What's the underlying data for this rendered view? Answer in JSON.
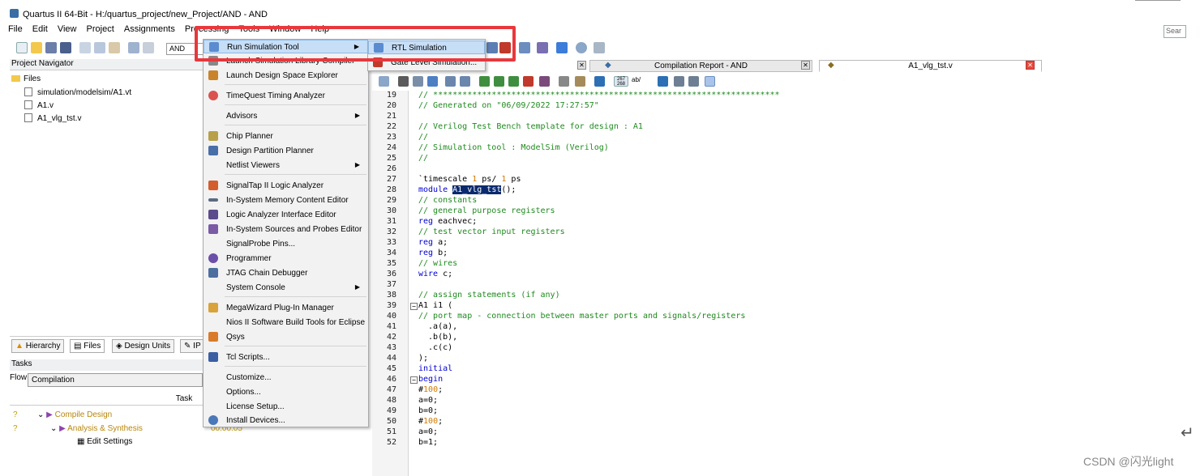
{
  "window": {
    "title": "Quartus II 64-Bit - H:/quartus_project/new_Project/AND - AND"
  },
  "menubar": [
    "File",
    "Edit",
    "View",
    "Project",
    "Assignments",
    "Processing",
    "Tools",
    "Window",
    "Help"
  ],
  "search_placeholder": "Sear",
  "toolbar": {
    "entity": "AND"
  },
  "project_navigator": {
    "title": "Project Navigator",
    "root": "Files",
    "files": [
      "simulation/modelsim/A1.vt",
      "A1.v",
      "A1_vlg_tst.v"
    ]
  },
  "panel_tabs": [
    "Hierarchy",
    "Files",
    "Design Units",
    "IP"
  ],
  "tasks": {
    "title": "Tasks",
    "flow_label": "Flow:",
    "flow_value": "Compilation",
    "column": "Task",
    "rows": [
      {
        "status": "?",
        "name": "Compile Design",
        "time": ""
      },
      {
        "status": "?",
        "name": "Analysis & Synthesis",
        "time": "00:00:05"
      },
      {
        "status": "",
        "name": "Edit Settings",
        "time": ""
      }
    ]
  },
  "editor_tabs": [
    {
      "label": "Compilation Report - AND"
    },
    {
      "label": "A1_vlg_tst.v"
    }
  ],
  "editor_toolbar": {
    "counter": "267\n268",
    "ab": "ab/"
  },
  "code": {
    "lines": [
      {
        "n": "19",
        "t": "// ***********************************************************************",
        "cls": "c-comment"
      },
      {
        "n": "20",
        "t": "// Generated on \"06/09/2022 17:27:57\"",
        "cls": "c-comment"
      },
      {
        "n": "21",
        "t": "",
        "cls": ""
      },
      {
        "n": "22",
        "t": "// Verilog Test Bench template for design : A1",
        "cls": "c-comment"
      },
      {
        "n": "23",
        "t": "//",
        "cls": "c-comment"
      },
      {
        "n": "24",
        "t": "// Simulation tool : ModelSim (Verilog)",
        "cls": "c-comment"
      },
      {
        "n": "25",
        "t": "//",
        "cls": "c-comment"
      },
      {
        "n": "26",
        "t": "",
        "cls": ""
      },
      {
        "n": "27",
        "t": "`timescale 1 ps/ 1 ps",
        "cls": ""
      },
      {
        "n": "28",
        "t": "module A1_vlg_tst();",
        "cls": ""
      },
      {
        "n": "29",
        "t": "// constants",
        "cls": "c-comment"
      },
      {
        "n": "30",
        "t": "// general purpose registers",
        "cls": "c-comment"
      },
      {
        "n": "31",
        "t": "reg eachvec;",
        "cls": ""
      },
      {
        "n": "32",
        "t": "// test vector input registers",
        "cls": "c-comment"
      },
      {
        "n": "33",
        "t": "reg a;",
        "cls": ""
      },
      {
        "n": "34",
        "t": "reg b;",
        "cls": ""
      },
      {
        "n": "35",
        "t": "// wires",
        "cls": "c-comment"
      },
      {
        "n": "36",
        "t": "wire c;",
        "cls": ""
      },
      {
        "n": "37",
        "t": "",
        "cls": ""
      },
      {
        "n": "38",
        "t": "// assign statements (if any)",
        "cls": "c-comment"
      },
      {
        "n": "39",
        "t": "A1 i1 (",
        "cls": ""
      },
      {
        "n": "40",
        "t": "// port map - connection between master ports and signals/registers",
        "cls": "c-comment"
      },
      {
        "n": "41",
        "t": "  .a(a),",
        "cls": ""
      },
      {
        "n": "42",
        "t": "  .b(b),",
        "cls": ""
      },
      {
        "n": "43",
        "t": "  .c(c)",
        "cls": ""
      },
      {
        "n": "44",
        "t": ");",
        "cls": ""
      },
      {
        "n": "45",
        "t": "initial",
        "cls": "c-kw"
      },
      {
        "n": "46",
        "t": "begin",
        "cls": "c-kw"
      },
      {
        "n": "47",
        "t": "#100;",
        "cls": ""
      },
      {
        "n": "48",
        "t": "a=0;",
        "cls": ""
      },
      {
        "n": "49",
        "t": "b=0;",
        "cls": ""
      },
      {
        "n": "50",
        "t": "#100;",
        "cls": ""
      },
      {
        "n": "51",
        "t": "a=0;",
        "cls": ""
      },
      {
        "n": "52",
        "t": "b=1;",
        "cls": ""
      }
    ]
  },
  "tools_menu": {
    "items": [
      "Run Simulation Tool",
      "Launch Simulation Library Compiler",
      "Launch Design Space Explorer",
      "TimeQuest Timing Analyzer",
      "Advisors",
      "Chip Planner",
      "Design Partition Planner",
      "Netlist Viewers",
      "SignalTap II Logic Analyzer",
      "In-System Memory Content Editor",
      "Logic Analyzer Interface Editor",
      "In-System Sources and Probes Editor",
      "SignalProbe Pins...",
      "Programmer",
      "JTAG Chain Debugger",
      "System Console",
      "MegaWizard Plug-In Manager",
      "Nios II Software Build Tools for Eclipse",
      "Qsys",
      "Tcl Scripts...",
      "Customize...",
      "Options...",
      "License Setup...",
      "Install Devices..."
    ]
  },
  "submenu": {
    "items": [
      "RTL Simulation",
      "Gate Level Simulation..."
    ]
  },
  "watermark": "CSDN @闪光light",
  "colors": {
    "highlight_box": "#e8383d",
    "menu_selected": "#c7def7",
    "comment": "#1f8a1f",
    "keyword": "#0000d0"
  }
}
